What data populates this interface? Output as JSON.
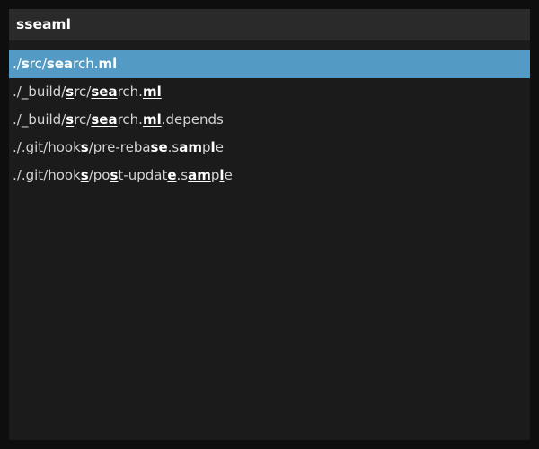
{
  "search": {
    "query": "sseaml"
  },
  "results": [
    {
      "selected": true,
      "segments": [
        {
          "t": "./",
          "m": false
        },
        {
          "t": "s",
          "m": true
        },
        {
          "t": "rc/",
          "m": false
        },
        {
          "t": "sea",
          "m": true
        },
        {
          "t": "rch.",
          "m": false
        },
        {
          "t": "ml",
          "m": true
        }
      ]
    },
    {
      "selected": false,
      "segments": [
        {
          "t": "./_build/",
          "m": false
        },
        {
          "t": "s",
          "m": true
        },
        {
          "t": "rc/",
          "m": false
        },
        {
          "t": "sea",
          "m": true
        },
        {
          "t": "rch.",
          "m": false
        },
        {
          "t": "ml",
          "m": true
        }
      ]
    },
    {
      "selected": false,
      "segments": [
        {
          "t": "./_build/",
          "m": false
        },
        {
          "t": "s",
          "m": true
        },
        {
          "t": "rc/",
          "m": false
        },
        {
          "t": "sea",
          "m": true
        },
        {
          "t": "rch.",
          "m": false
        },
        {
          "t": "ml",
          "m": true
        },
        {
          "t": ".depends",
          "m": false
        }
      ]
    },
    {
      "selected": false,
      "segments": [
        {
          "t": "./.git/hook",
          "m": false
        },
        {
          "t": "s",
          "m": true
        },
        {
          "t": "/pre-reba",
          "m": false
        },
        {
          "t": "se",
          "m": true
        },
        {
          "t": ".s",
          "m": false
        },
        {
          "t": "am",
          "m": true
        },
        {
          "t": "p",
          "m": false
        },
        {
          "t": "l",
          "m": true
        },
        {
          "t": "e",
          "m": false
        }
      ]
    },
    {
      "selected": false,
      "segments": [
        {
          "t": "./.git/hook",
          "m": false
        },
        {
          "t": "s",
          "m": true
        },
        {
          "t": "/po",
          "m": false
        },
        {
          "t": "s",
          "m": true
        },
        {
          "t": "t-updat",
          "m": false
        },
        {
          "t": "e",
          "m": true
        },
        {
          "t": ".s",
          "m": false
        },
        {
          "t": "am",
          "m": true
        },
        {
          "t": "p",
          "m": false
        },
        {
          "t": "l",
          "m": true
        },
        {
          "t": "e",
          "m": false
        }
      ]
    }
  ]
}
